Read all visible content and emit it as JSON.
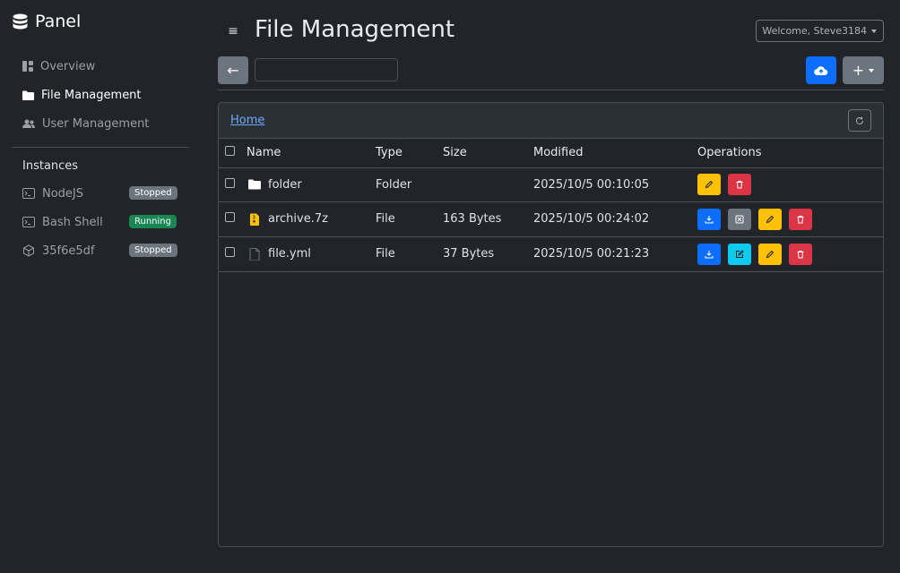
{
  "app": {
    "brand": "Panel"
  },
  "sidebar": {
    "nav": [
      {
        "label": "Overview",
        "icon": "dashboard-icon",
        "active": false
      },
      {
        "label": "File Management",
        "icon": "folder-icon",
        "active": true
      },
      {
        "label": "User Management",
        "icon": "users-icon",
        "active": false
      }
    ],
    "instances_title": "Instances",
    "instances": [
      {
        "label": "NodeJS",
        "icon": "terminal-icon",
        "status": "Stopped"
      },
      {
        "label": "Bash Shell",
        "icon": "terminal-icon",
        "status": "Running"
      },
      {
        "label": "35f6e5df",
        "icon": "box-icon",
        "status": "Stopped"
      }
    ]
  },
  "header": {
    "menu_icon": "≡",
    "title": "File Management",
    "welcome": "Welcome, Steve3184"
  },
  "toolbar": {
    "back_icon": "←",
    "path_value": "",
    "add_icon": "+"
  },
  "browser": {
    "breadcrumb": "Home",
    "columns": [
      "Name",
      "Type",
      "Size",
      "Modified",
      "Operations"
    ],
    "rows": [
      {
        "name": "folder",
        "type": "Folder",
        "size": "",
        "modified": "2025/10/5 00:10:05",
        "icon": "folder-icon"
      },
      {
        "name": "archive.7z",
        "type": "File",
        "size": "163 Bytes",
        "modified": "2025/10/5 00:24:02",
        "icon": "archive-icon"
      },
      {
        "name": "file.yml",
        "type": "File",
        "size": "37 Bytes",
        "modified": "2025/10/5 00:21:23",
        "icon": "file-icon"
      }
    ]
  },
  "colors": {
    "background": "#212529",
    "primary": "#0d6efd",
    "secondary": "#6c757d",
    "warning": "#ffc107",
    "danger": "#dc3545",
    "info": "#0dcaf0",
    "success": "#198754",
    "link": "#6ea8fe"
  }
}
